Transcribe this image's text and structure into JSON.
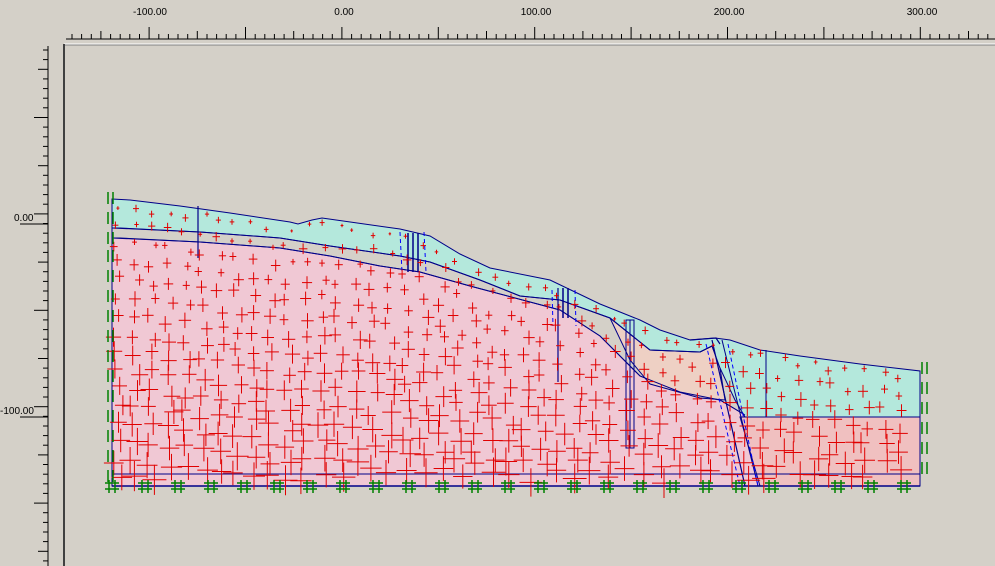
{
  "rulers": {
    "x_labels": [
      "-100.00",
      "0.00",
      "100.00",
      "200.00",
      "300.00"
    ],
    "y_labels": [
      "0.00",
      "-100.00"
    ]
  },
  "colors": {
    "canvas_bg": "#d4d0c8",
    "layer_top": "#b4e8dc",
    "layer_main": "#f0c8d4",
    "layer_right": "#f0c0c0",
    "wedge": "#eed0c4",
    "outline": "#000088",
    "stress_cross": "#e00000",
    "fixity": "#008000"
  },
  "icons": {
    "fixity": "fixity-symbol-icon",
    "vertical_fixity": "vertical-fixity-icon"
  }
}
